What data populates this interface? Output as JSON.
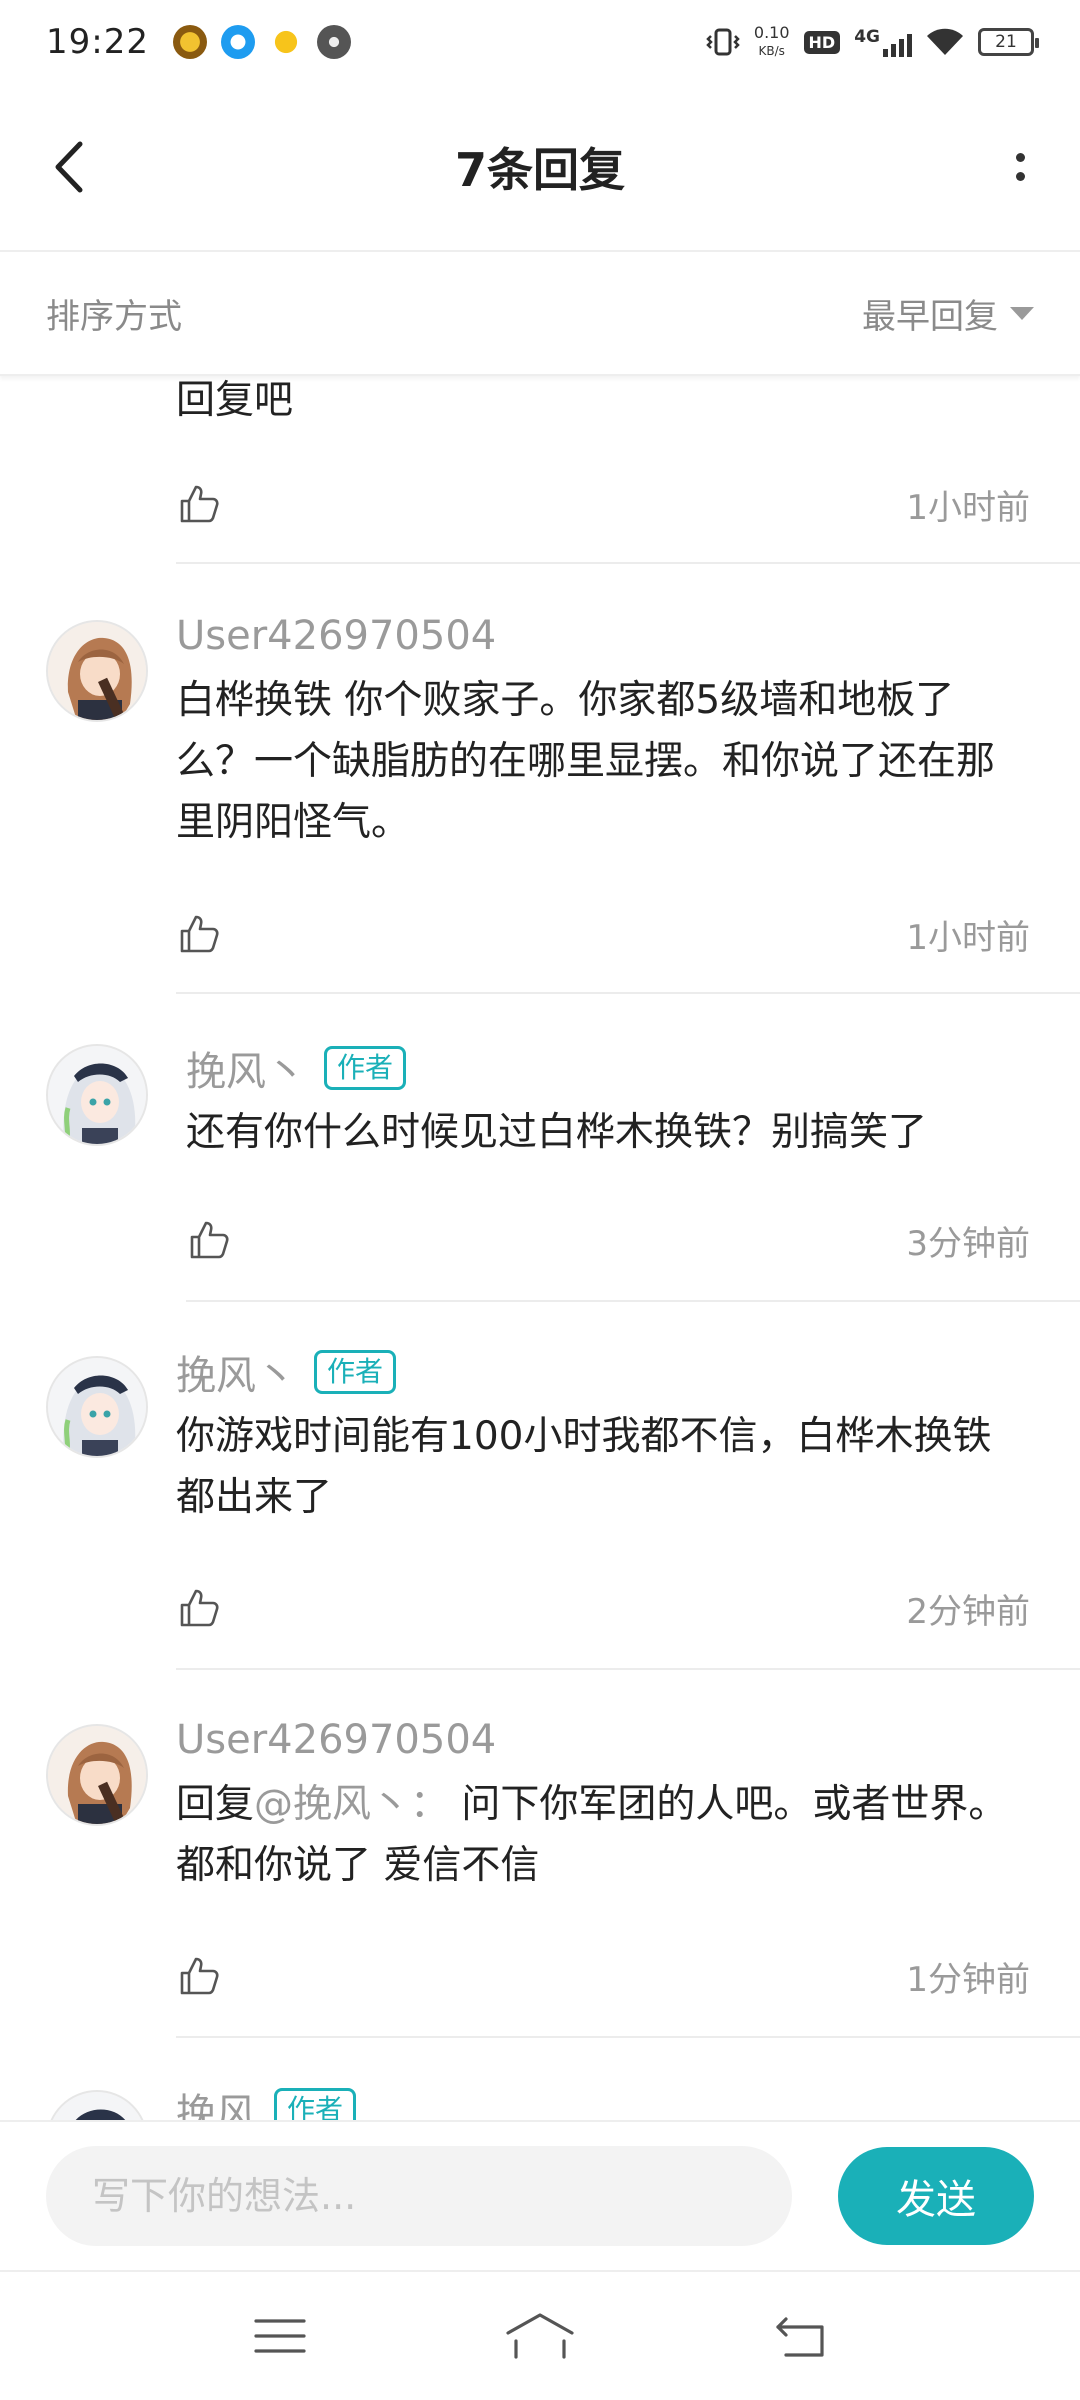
{
  "status_bar": {
    "time": "19:22",
    "net_speed_value": "0.10",
    "net_speed_unit": "KB/s",
    "hd_label": "HD",
    "network_label": "4G",
    "battery": "21",
    "notification_icons": [
      "game-app-icon",
      "compass-app-icon",
      "duck-app-icon",
      "dark-app-icon"
    ]
  },
  "header": {
    "title": "7条回复"
  },
  "sort": {
    "label": "排序方式",
    "value": "最早回复"
  },
  "comments": [
    {
      "name": "",
      "is_author": false,
      "text": "回复吧",
      "time": "1小时前"
    },
    {
      "name": "User426970504",
      "is_author": false,
      "text": "白桦换铁  你个败家子。你家都5级墙和地板了么？一个缺脂肪的在哪里显摆。和你说了还在那里阴阳怪气。",
      "time": "1小时前"
    },
    {
      "name": "挽风丶",
      "is_author": true,
      "text": "还有你什么时候见过白桦木换铁？别搞笑了",
      "time": "3分钟前"
    },
    {
      "name": "挽风丶",
      "is_author": true,
      "text": "你游戏时间能有100小时我都不信，白桦木换铁都出来了",
      "time": "2分钟前"
    },
    {
      "name": "User426970504",
      "is_author": false,
      "reply_prefix": "回复",
      "mention": "@挽风丶：",
      "text": " 问下你军团的人吧。或者世界。都和你说了  爱信不信",
      "time": "1分钟前"
    },
    {
      "name": "挽风",
      "is_author": true,
      "text": "",
      "time": ""
    }
  ],
  "author_badge": "作者",
  "input": {
    "placeholder": "写下你的想法..."
  },
  "send_label": "发送",
  "colors": {
    "accent": "#1ab0b8",
    "secondary_text": "#9a9a9a"
  }
}
